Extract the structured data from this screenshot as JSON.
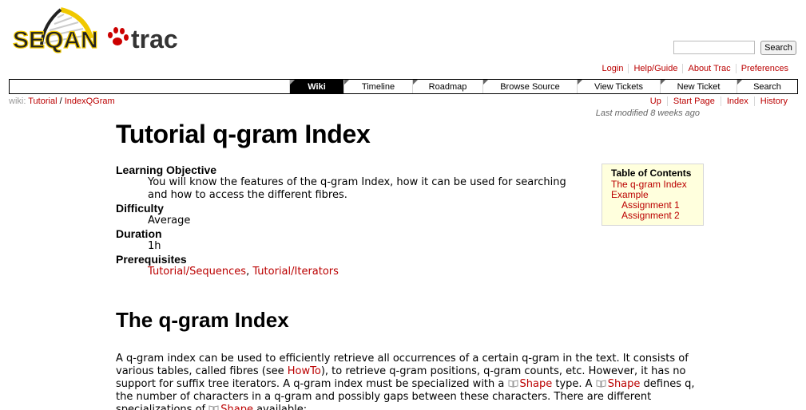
{
  "header": {
    "logo_text_left": "SEQAN",
    "logo_text_right": "trac",
    "search_placeholder": "",
    "search_button": "Search"
  },
  "metanav": [
    "Login",
    "Help/Guide",
    "About Trac",
    "Preferences"
  ],
  "mainnav": [
    {
      "label": "Wiki",
      "active": true
    },
    {
      "label": "Timeline",
      "active": false
    },
    {
      "label": "Roadmap",
      "active": false
    },
    {
      "label": "Browse Source",
      "active": false
    },
    {
      "label": "View Tickets",
      "active": false
    },
    {
      "label": "New Ticket",
      "active": false
    },
    {
      "label": "Search",
      "active": false
    }
  ],
  "breadcrumb": {
    "prefix": "wiki:",
    "parts": [
      "Tutorial",
      "IndexQGram"
    ],
    "sep": " / "
  },
  "ctxnav": [
    "Up",
    "Start Page",
    "Index",
    "History"
  ],
  "last_modified": "Last modified 8 weeks ago",
  "page": {
    "title": "Tutorial q-gram Index",
    "definitions": [
      {
        "term": "Learning Objective",
        "desc": "You will know the features of the q-gram Index, how it can be used for searching and how to access the different fibres."
      },
      {
        "term": "Difficulty",
        "desc": "Average"
      },
      {
        "term": "Duration",
        "desc": "1h"
      },
      {
        "term": "Prerequisites",
        "links": [
          "Tutorial/Sequences",
          "Tutorial/Iterators"
        ]
      }
    ],
    "toc": {
      "title": "Table of Contents",
      "items": [
        {
          "label": "The q-gram Index",
          "level": 1
        },
        {
          "label": "Example",
          "level": 1
        },
        {
          "label": "Assignment 1",
          "level": 2
        },
        {
          "label": "Assignment 2",
          "level": 2
        }
      ]
    },
    "section_title": "The q-gram Index",
    "para": {
      "t1": "A q-gram index can be used to efficiently retrieve all occurrences of a certain q-gram in the text. It consists of various tables, called fibres (see ",
      "link1": "HowTo",
      "t2": "), to retrieve q-gram positions, q-gram counts, etc. However, it has no support for suffix tree iterators. A q-gram index must be specialized with a ",
      "link2": "Shape",
      "t3": " type. A ",
      "link3": "Shape",
      "t4": " defines q, the number of characters in a q-gram and possibly gaps between these characters. There are different specializations of ",
      "link4": "Shape",
      "t5": " available:"
    }
  },
  "colors": {
    "link": "#bb0000",
    "nav_active": "#000000",
    "toc_bg": "#ffffdd"
  }
}
